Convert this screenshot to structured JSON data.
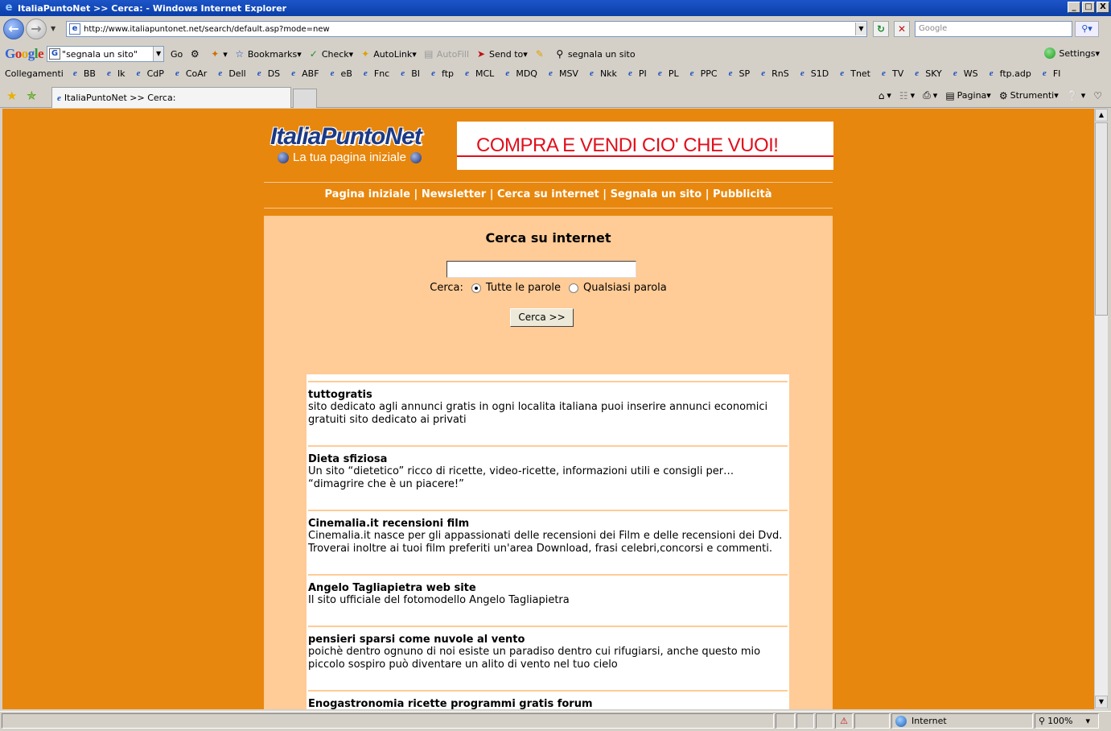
{
  "window": {
    "title": "ItaliaPuntoNet >> Cerca: - Windows Internet Explorer",
    "minimize": "_",
    "maximize": "□",
    "close": "X"
  },
  "address": {
    "url": "http://www.italiapuntonet.net/search/default.asp?mode=new",
    "search_placeholder": "Google"
  },
  "google_toolbar": {
    "search_value": "\"segnala un sito\"",
    "go_label": "Go",
    "bookmarks_label": "Bookmarks",
    "check_label": "Check",
    "autolink_label": "AutoLink",
    "autofill_label": "AutoFill",
    "sendto_label": "Send to",
    "highlight_term": "segnala un sito",
    "settings_label": "Settings"
  },
  "links_bar": {
    "title": "Collegamenti",
    "items": [
      "BB",
      "Ik",
      "CdP",
      "CoAr",
      "Dell",
      "DS",
      "ABF",
      "eB",
      "Fnc",
      "BI",
      "ftp",
      "MCL",
      "MDQ",
      "MSV",
      "Nkk",
      "PI",
      "PL",
      "PPC",
      "SP",
      "RnS",
      "S1D",
      "Tnet",
      "TV",
      "SKY",
      "WS",
      "ftp.adp",
      "FI"
    ]
  },
  "tabs": {
    "active_label": "ItaliaPuntoNet >> Cerca:",
    "page_label": "Pagina",
    "tools_label": "Strumenti"
  },
  "page": {
    "logo_title": "ItaliaPuntoNet",
    "logo_tagline": "La tua pagina iniziale",
    "banner_text": "COMPRA E VENDI CIO' CHE VUOI!",
    "nav": [
      "Pagina iniziale",
      "Newsletter",
      "Cerca su internet",
      "Segnala un sito",
      "Pubblicità"
    ],
    "nav_separator": "|",
    "panel_title": "Cerca su internet",
    "search_value": "",
    "cerca_label": "Cerca:",
    "option_all": "Tutte le parole",
    "option_any": "Qualsiasi parola",
    "option_all_selected": true,
    "button_label": "Cerca >>",
    "results": [
      {
        "title": "tuttogratis",
        "desc": "sito dedicato agli annunci gratis in ogni localita italiana puoi inserire annunci economici gratuiti sito dedicato ai privati"
      },
      {
        "title": "Dieta sfiziosa",
        "desc": "Un sito “dietetico” ricco di ricette, video-ricette, informazioni utili e consigli per… “dimagrire che è un piacere!”"
      },
      {
        "title": "Cinemalia.it recensioni film",
        "desc": "Cinemalia.it nasce per gli appassionati delle recensioni dei Film e delle recensioni dei Dvd. Troverai inoltre ai tuoi film preferiti un'area Download, frasi celebri,concorsi e commenti."
      },
      {
        "title": "Angelo Tagliapietra web site",
        "desc": "Il sito ufficiale del fotomodello Angelo Tagliapietra"
      },
      {
        "title": "pensieri sparsi come nuvole al vento",
        "desc": "poichè dentro ognuno di noi esiste un paradiso dentro cui rifugiarsi, anche questo mio piccolo sospiro può diventare un alito di vento nel tuo cielo"
      },
      {
        "title": "Enogastronomia ricette programmi gratis forum",
        "desc": ""
      }
    ]
  },
  "status": {
    "zone": "Internet",
    "zoom": "100%"
  },
  "colors": {
    "page_bg": "#e8870d",
    "panel_bg": "#ffcb96",
    "banner_red": "#e0101c"
  }
}
